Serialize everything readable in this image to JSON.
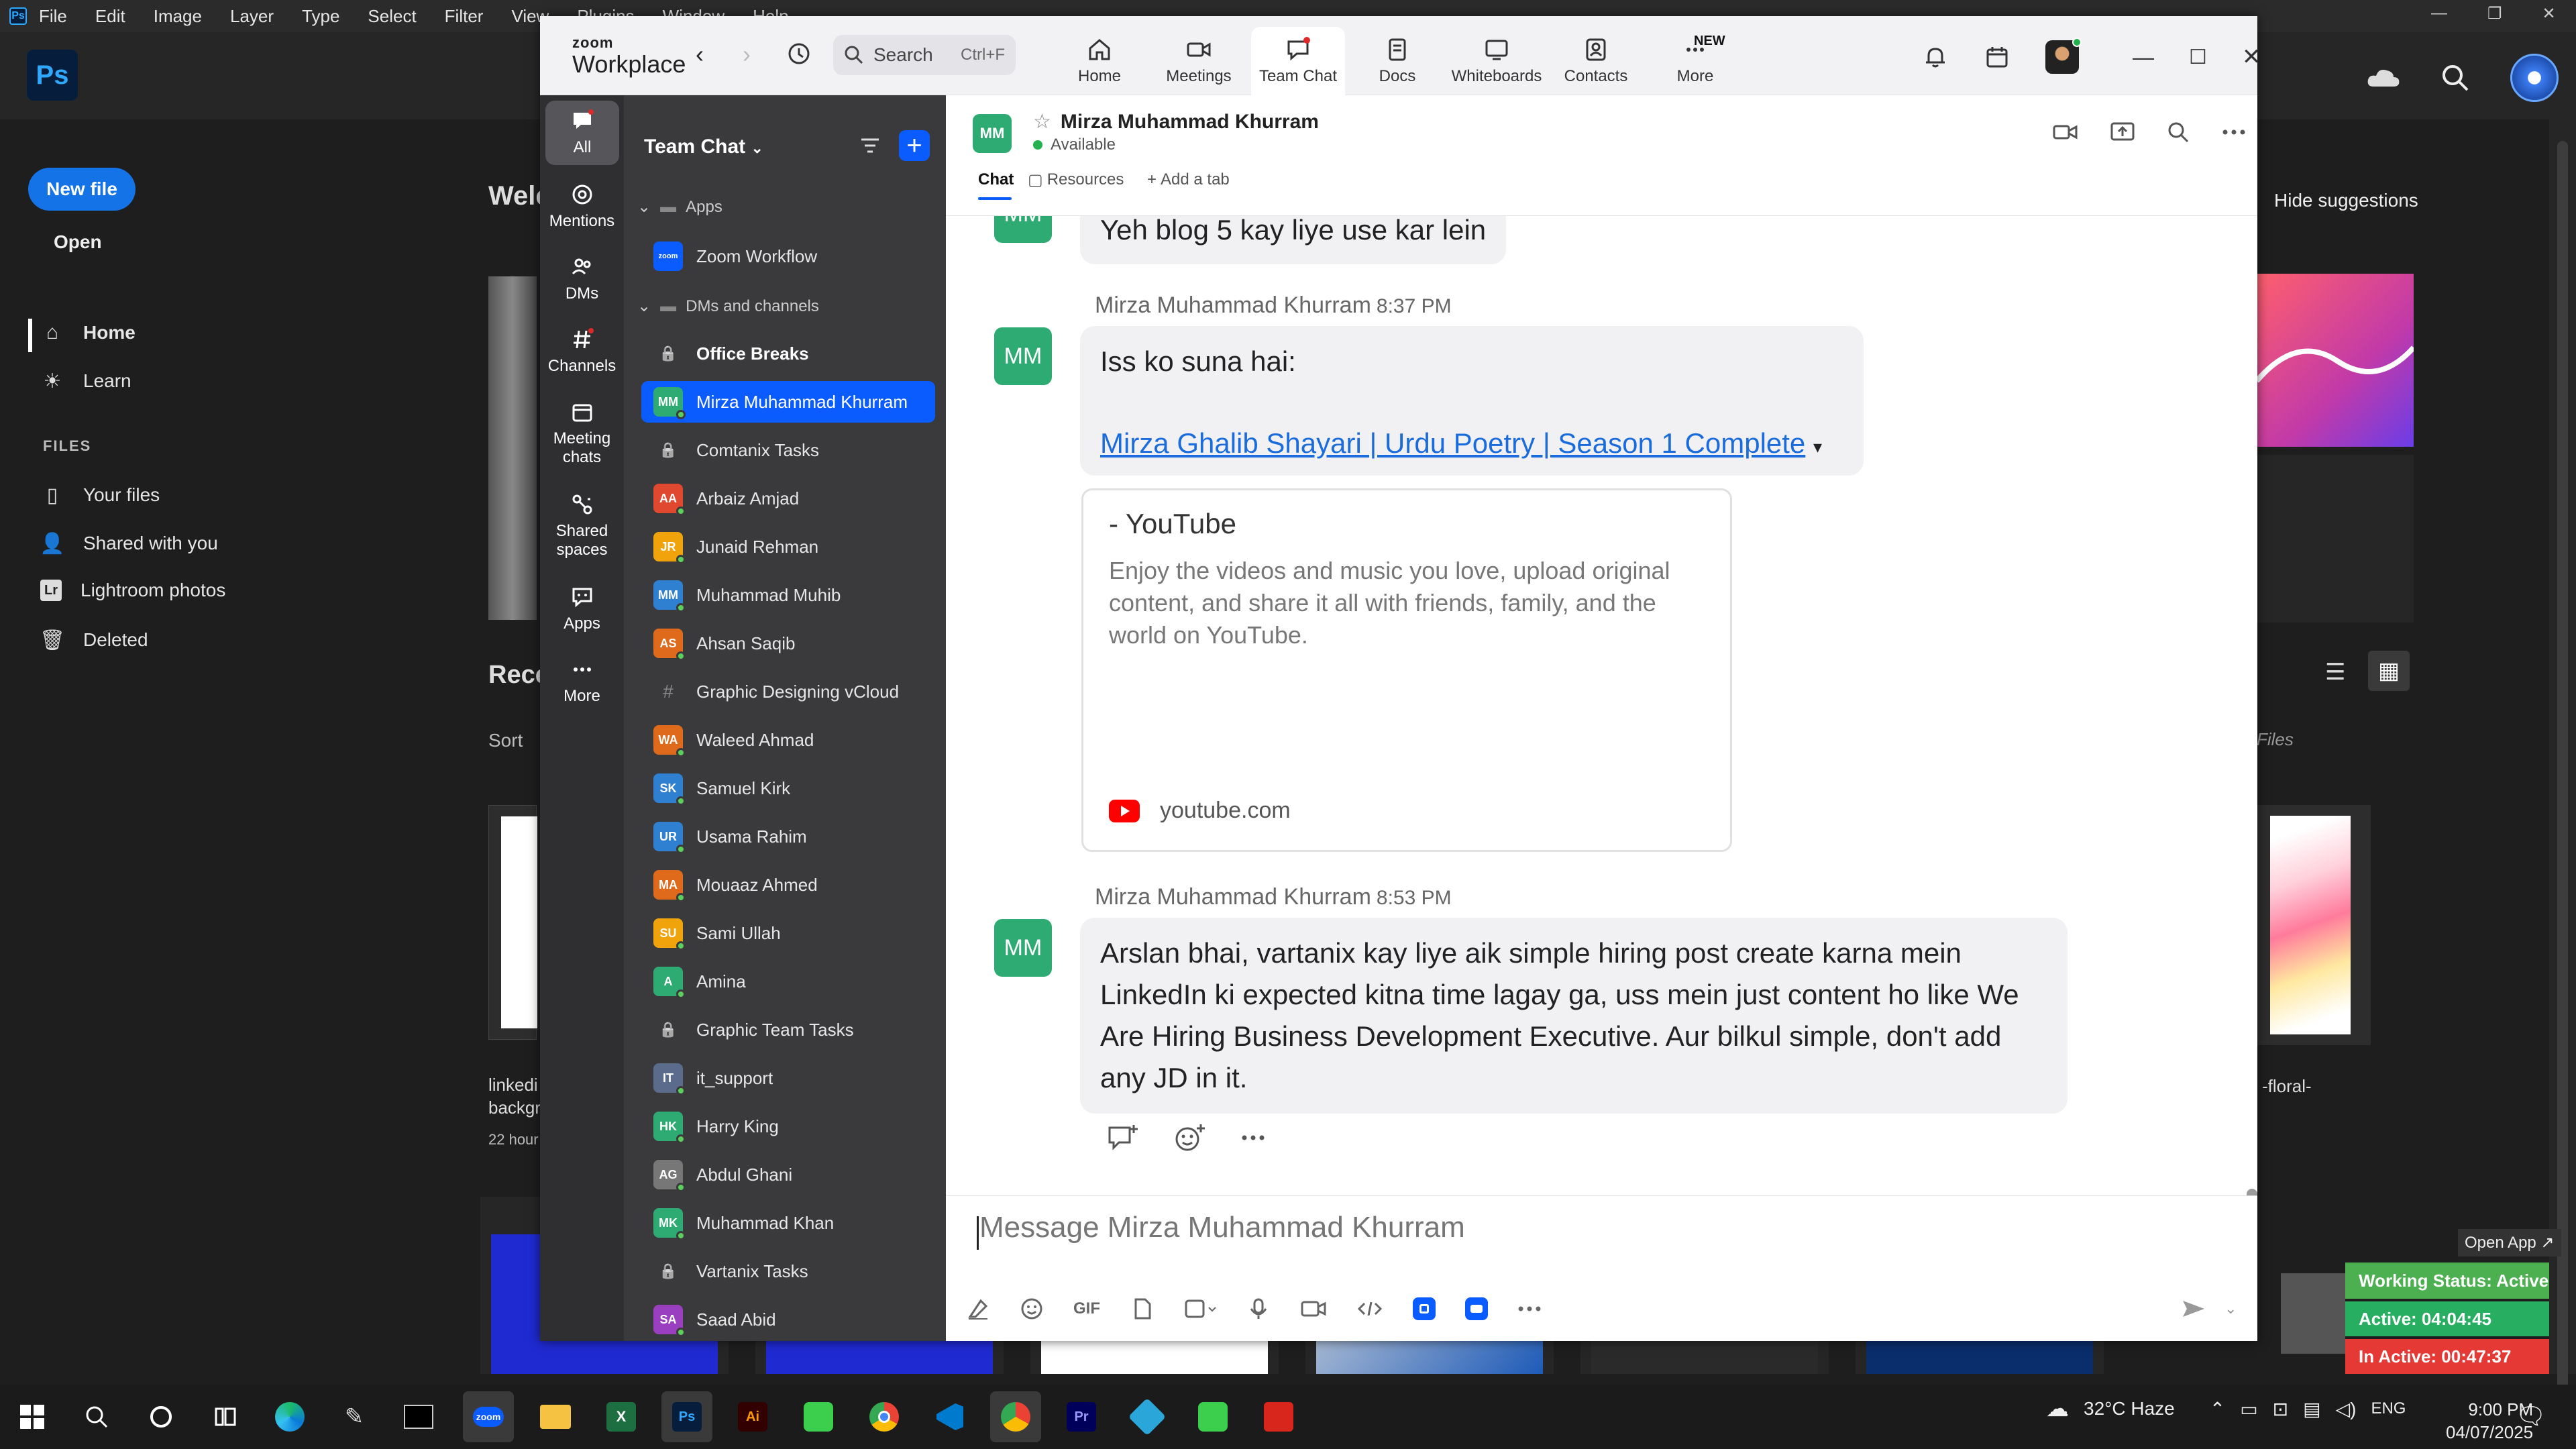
{
  "photoshop": {
    "menu": [
      "File",
      "Edit",
      "Image",
      "Layer",
      "Type",
      "Select",
      "Filter",
      "View",
      "Plugins",
      "Window",
      "Help"
    ],
    "new_file": "New file",
    "open": "Open",
    "nav": [
      {
        "label": "Home",
        "icon": "home-icon"
      },
      {
        "label": "Learn",
        "icon": "lightbulb-icon"
      }
    ],
    "files_header": "FILES",
    "files": [
      {
        "label": "Your files",
        "icon": "file-icon"
      },
      {
        "label": "Shared with you",
        "icon": "people-icon"
      },
      {
        "label": "Lightroom photos",
        "icon": "lightroom-icon"
      },
      {
        "label": "Deleted",
        "icon": "trash-icon"
      }
    ],
    "welcome": "Welc",
    "recent": "Rece",
    "sort": "Sort",
    "linkedin_1": "linkedi",
    "linkedin_2": "backgr",
    "hours": "22 hour",
    "hide_suggestions": "Hide suggestions",
    "files_label": "Files",
    "floral_label": "-floral-"
  },
  "zoom": {
    "brand_small": "zoom",
    "brand": "Workplace",
    "search": {
      "placeholder": "Search",
      "shortcut": "Ctrl+F"
    },
    "topnav": [
      {
        "label": "Home",
        "icon": "home-icon"
      },
      {
        "label": "Meetings",
        "icon": "video-camera-icon"
      },
      {
        "label": "Team Chat",
        "icon": "chat-bubble-icon",
        "active": true
      },
      {
        "label": "Docs",
        "icon": "document-icon"
      },
      {
        "label": "Whiteboards",
        "icon": "whiteboard-icon"
      },
      {
        "label": "Contacts",
        "icon": "contacts-icon"
      },
      {
        "label": "More",
        "icon": "more-dots-icon"
      }
    ],
    "new_badge": "NEW",
    "leftnav": [
      {
        "label": "All",
        "icon": "chat-bubble-icon"
      },
      {
        "label": "Mentions",
        "icon": "at-icon"
      },
      {
        "label": "DMs",
        "icon": "people-icon"
      },
      {
        "label": "Channels",
        "icon": "hash-icon"
      },
      {
        "label": "Meeting chats",
        "icon": "calendar-icon"
      },
      {
        "label": "Shared spaces",
        "icon": "shared-spaces-icon"
      },
      {
        "label": "Apps",
        "icon": "apps-chat-icon"
      },
      {
        "label": "More",
        "icon": "more-dots-icon"
      }
    ],
    "teamchat_title": "Team Chat",
    "sections": {
      "apps": "Apps",
      "dms": "DMs and channels"
    },
    "app_item": "Zoom Workflow",
    "conversations": [
      {
        "name": "Office Breaks",
        "type": "lock",
        "bold": true
      },
      {
        "name": "Mirza Muhammad Khurram",
        "initials": "MM",
        "color": "#2eab73",
        "selected": true
      },
      {
        "name": "Comtanix Tasks",
        "type": "lock"
      },
      {
        "name": "Arbaiz Amjad",
        "initials": "AA",
        "color": "#e0492f"
      },
      {
        "name": "Junaid Rehman",
        "initials": "JR",
        "color": "#f0a30a"
      },
      {
        "name": "Muhammad Muhib",
        "initials": "MM",
        "color": "#2f80d1"
      },
      {
        "name": "Ahsan Saqib",
        "initials": "AS",
        "color": "#e06a1b"
      },
      {
        "name": "Graphic Designing vCloud",
        "type": "hash"
      },
      {
        "name": "Waleed Ahmad",
        "initials": "WA",
        "color": "#e06a1b"
      },
      {
        "name": "Samuel Kirk",
        "initials": "SK",
        "color": "#2f80d1"
      },
      {
        "name": "Usama Rahim",
        "initials": "UR",
        "color": "#2f80d1"
      },
      {
        "name": "Mouaaz Ahmed",
        "initials": "MA",
        "color": "#e06a1b"
      },
      {
        "name": "Sami Ullah",
        "initials": "SU",
        "color": "#f0a30a"
      },
      {
        "name": "Amina",
        "initials": "A",
        "color": "#2eab73"
      },
      {
        "name": "Graphic Team Tasks",
        "type": "lock"
      },
      {
        "name": "it_support",
        "initials": "IT",
        "color": "#5a6b8c"
      },
      {
        "name": "Harry King",
        "initials": "HK",
        "color": "#2eab73"
      },
      {
        "name": "Abdul Ghani",
        "initials": "AG",
        "color": "#777777"
      },
      {
        "name": "Muhammad Khan",
        "initials": "MK",
        "color": "#2eab73"
      },
      {
        "name": "Vartanix Tasks",
        "type": "lock"
      },
      {
        "name": "Saad Abid",
        "initials": "SA",
        "color": "#9b3fc1"
      }
    ],
    "chat": {
      "contact": "Mirza Muhammad Khurram",
      "initials": "MM",
      "status": "Available",
      "tabs": {
        "chat": "Chat",
        "resources": "Resources",
        "add": "Add a tab"
      },
      "partial_message": "Yeh blog 5 kay liye use kar lein",
      "messages": [
        {
          "sender": "Mirza Muhammad Khurram",
          "time": "8:37 PM",
          "text": "Iss ko suna hai:",
          "link": "Mirza Ghalib Shayari | Urdu Poetry | Season 1 Complete"
        },
        {
          "sender": "Mirza Muhammad Khurram",
          "time": "8:53 PM",
          "text": "Arslan bhai, vartanix kay liye aik simple hiring post create karna mein LinkedIn ki expected kitna time lagay ga, uss mein just content ho like We Are Hiring Business Development Executive. Aur bilkul simple, don't add any JD in it."
        }
      ],
      "preview": {
        "title": "- YouTube",
        "description": "Enjoy the videos and music you love, upload original content, and share it all with friends, family, and the world on YouTube.",
        "domain": "youtube.com"
      },
      "composer_placeholder": "Message Mirza Muhammad Khurram"
    }
  },
  "widget": {
    "open_app": "Open App ↗",
    "working_status": "Working Status: Active",
    "active": "Active: 04:04:45",
    "inactive": "In Active: 00:47:37"
  },
  "taskbar": {
    "weather": "32°C  Haze",
    "language": "ENG",
    "time": "9:00 PM",
    "date": "04/07/2025"
  }
}
